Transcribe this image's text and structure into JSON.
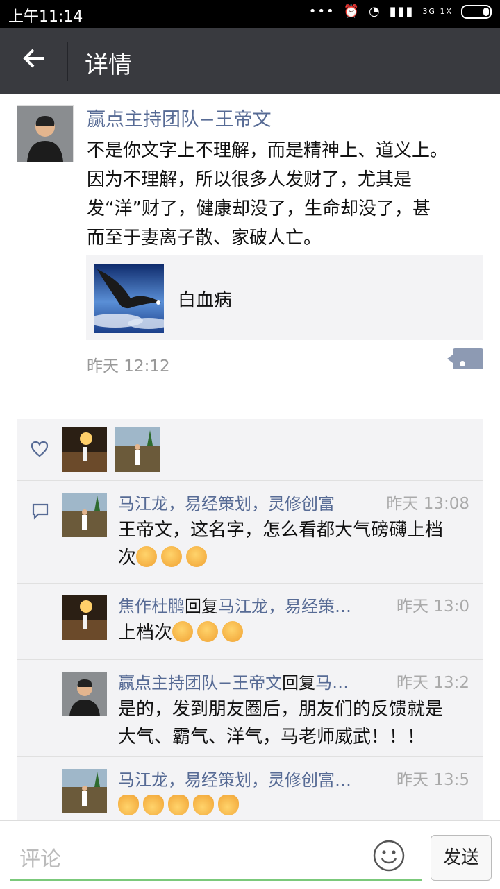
{
  "status_bar": {
    "time": "上午11:14",
    "network": "3G 1X"
  },
  "app_bar": {
    "title": "详情"
  },
  "post": {
    "author": "赢点主持团队−王帝文",
    "text_lines": [
      "不是你文字上不理解，而是精神上、道义上。",
      "因为不理解，所以很多人发财了，尤其是",
      "发“洋”财了，健康却没了，生命却没了，甚",
      "而至于妻离子散、家破人亡。"
    ],
    "link": {
      "title": "白血病",
      "thumb_icon": "eagle-image"
    },
    "time": "昨天 12:12"
  },
  "likes": {
    "icon": "heart-icon"
  },
  "comments": [
    {
      "name": "马江龙，易经策划，灵修创富",
      "reply_word": "",
      "reply_to": "",
      "time": "昨天 13:08",
      "lines": [
        "王帝文，这名字，怎么看都大气磅礴上档",
        "次"
      ],
      "emoji_count": 3
    },
    {
      "name": "焦作杜鹏",
      "reply_word": "回复",
      "reply_to": "马江龙，易经策…",
      "time": "昨天 13:0",
      "lines": [
        "上档次"
      ],
      "emoji_count": 3
    },
    {
      "name": "赢点主持团队−王帝文",
      "reply_word": "回复",
      "reply_to": "马…",
      "time": "昨天 13:2",
      "lines": [
        "是的，发到朋友圈后，朋友们的反馈就是",
        "大气、霸气、洋气，马老师威武！！！"
      ],
      "emoji_count": 0
    },
    {
      "name": "马江龙，易经策划，灵修创富…",
      "reply_word": "",
      "reply_to": "",
      "time": "昨天 13:5",
      "lines": [
        ""
      ],
      "emoji_count": 5
    }
  ],
  "comment_bar": {
    "placeholder": "评论",
    "send_label": "发送"
  },
  "colors": {
    "link_blue": "#576b95",
    "app_bar": "#393a3f",
    "input_underline": "#7bc97b"
  }
}
